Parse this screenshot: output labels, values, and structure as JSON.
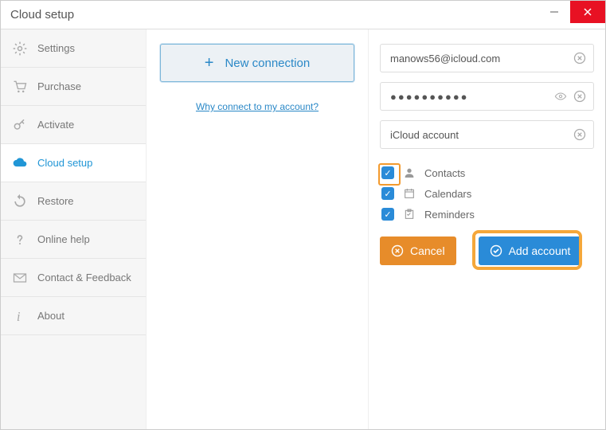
{
  "window": {
    "title": "Cloud setup"
  },
  "sidebar": {
    "items": [
      {
        "label": "Settings"
      },
      {
        "label": "Purchase"
      },
      {
        "label": "Activate"
      },
      {
        "label": "Cloud setup"
      },
      {
        "label": "Restore"
      },
      {
        "label": "Online help"
      },
      {
        "label": "Contact & Feedback"
      },
      {
        "label": "About"
      }
    ]
  },
  "middle": {
    "new_connection_label": "New connection",
    "why_link": "Why connect to my account?"
  },
  "form": {
    "email": "manows56@icloud.com",
    "password": "●●●●●●●●●●",
    "account_name": "iCloud account",
    "checks": [
      {
        "label": "Contacts"
      },
      {
        "label": "Calendars"
      },
      {
        "label": "Reminders"
      }
    ],
    "cancel_label": "Cancel",
    "add_label": "Add account"
  }
}
